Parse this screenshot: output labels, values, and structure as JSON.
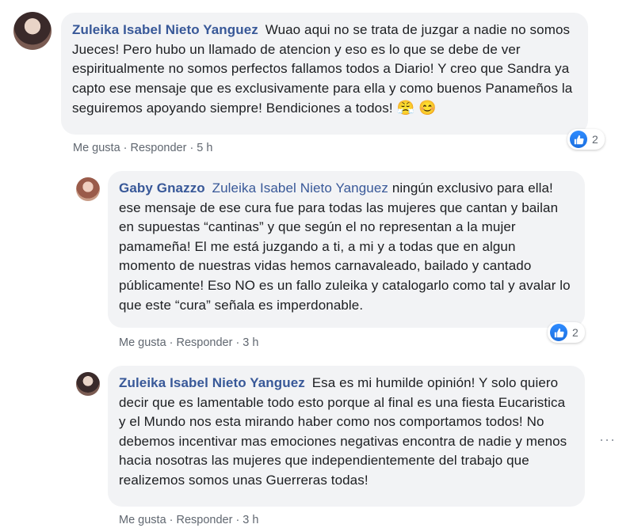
{
  "comments": [
    {
      "author": "Zuleika Isabel Nieto Yanguez",
      "mention": "",
      "text": "Wuao aqui no se trata de juzgar a nadie no somos Jueces! Pero hubo un llamado de atencion y eso es lo que se debe de ver espiritualmente no somos perfectos fallamos todos a Diario! Y creo que Sandra ya capto ese mensaje que es exclusivamente para ella y como buenos Panameños la seguiremos apoyando siempre! Bendiciones a todos!",
      "emoji": "😤 😊",
      "like_label": "Me gusta",
      "reply_label": "Responder",
      "time": "5 h",
      "reactions": "2"
    },
    {
      "author": "Gaby Gnazzo",
      "mention": "Zuleika Isabel Nieto Yanguez",
      "text": "ningún exclusivo para ella! ese mensaje de ese cura fue para todas las mujeres que cantan y bailan en supuestas “cantinas” y que según el no representan a la mujer pamameña! El me está juzgando a ti, a mi y a todas que en algun momento de nuestras vidas hemos carnavaleado, bailado y cantado públicamente! Eso NO es un fallo zuleika y catalogarlo como tal y avalar lo que este “cura” señala es imperdonable.",
      "like_label": "Me gusta",
      "reply_label": "Responder",
      "time": "3 h",
      "reactions": "2"
    },
    {
      "author": "Zuleika Isabel Nieto Yanguez",
      "mention": "",
      "text": "Esa es mi humilde opinión! Y solo quiero decir que es lamentable todo esto porque al final es una fiesta Eucaristica y el Mundo nos esta mirando haber como nos comportamos todos! No debemos incentivar mas emociones negativas encontra de nadie y menos hacia nosotras las mujeres que independientemente del trabajo que realizemos somos unas Guerreras todas!",
      "like_label": "Me gusta",
      "reply_label": "Responder",
      "time": "3 h"
    }
  ],
  "separator": "·",
  "icons": {
    "like": "like-thumb-icon",
    "more": "more-options-icon"
  },
  "colors": {
    "author": "#385898",
    "bubble": "#f2f3f5",
    "like_blue": "#1b6fe0"
  }
}
